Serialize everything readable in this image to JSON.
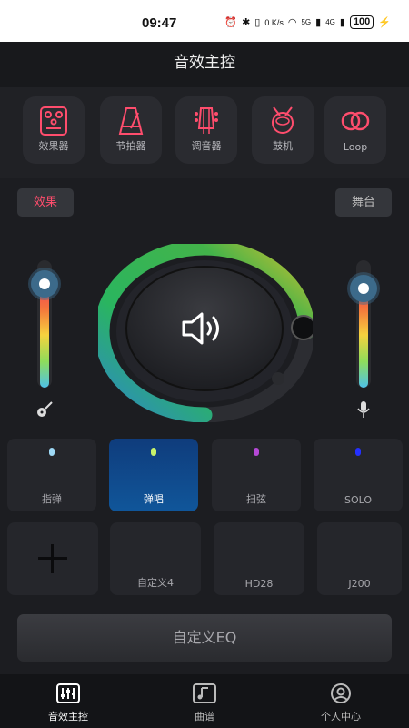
{
  "status_bar": {
    "time": "09:47",
    "net_speed": "0 K/s",
    "signal_5g": "5G",
    "signal_4g": "4G",
    "battery": "100"
  },
  "header": {
    "title": "音效主控"
  },
  "tools": [
    {
      "label": "效果器",
      "icon": "effects-pedal-icon"
    },
    {
      "label": "节拍器",
      "icon": "metronome-icon"
    },
    {
      "label": "调音器",
      "icon": "tuner-guitar-head-icon"
    },
    {
      "label": "鼓机",
      "icon": "drum-icon"
    },
    {
      "label": "Loop",
      "icon": "loop-icon"
    }
  ],
  "mode_tabs": {
    "effects": "效果",
    "stage": "舞台"
  },
  "sliders": {
    "left_level": 0.83,
    "right_level": 0.78,
    "left_icon": "guitar-icon",
    "right_icon": "microphone-icon"
  },
  "dial": {
    "icon": "speaker-volume-icon",
    "level": 0.75
  },
  "presets": [
    {
      "label": "指弹",
      "dot_color": "#9ed8f5",
      "active": false
    },
    {
      "label": "弹唱",
      "dot_color": "#c6f26b",
      "active": true
    },
    {
      "label": "扫弦",
      "dot_color": "#b548d6",
      "active": false
    },
    {
      "label": "SOLO",
      "dot_color": "#2430ff",
      "active": false
    }
  ],
  "custom_presets": [
    {
      "label": "",
      "icon": "add-icon"
    },
    {
      "label": "自定义4"
    },
    {
      "label": "HD28"
    },
    {
      "label": "J200"
    }
  ],
  "eq_button": {
    "label": "自定义EQ"
  },
  "bottom_nav": [
    {
      "label": "音效主控",
      "icon": "mixer-sliders-icon",
      "active": true
    },
    {
      "label": "曲谱",
      "icon": "music-note-icon",
      "active": false
    },
    {
      "label": "个人中心",
      "icon": "user-profile-icon",
      "active": false
    }
  ],
  "colors": {
    "accent_red": "#ff4d6d",
    "active_blue": "#10569a",
    "background": "#1c1d21"
  }
}
